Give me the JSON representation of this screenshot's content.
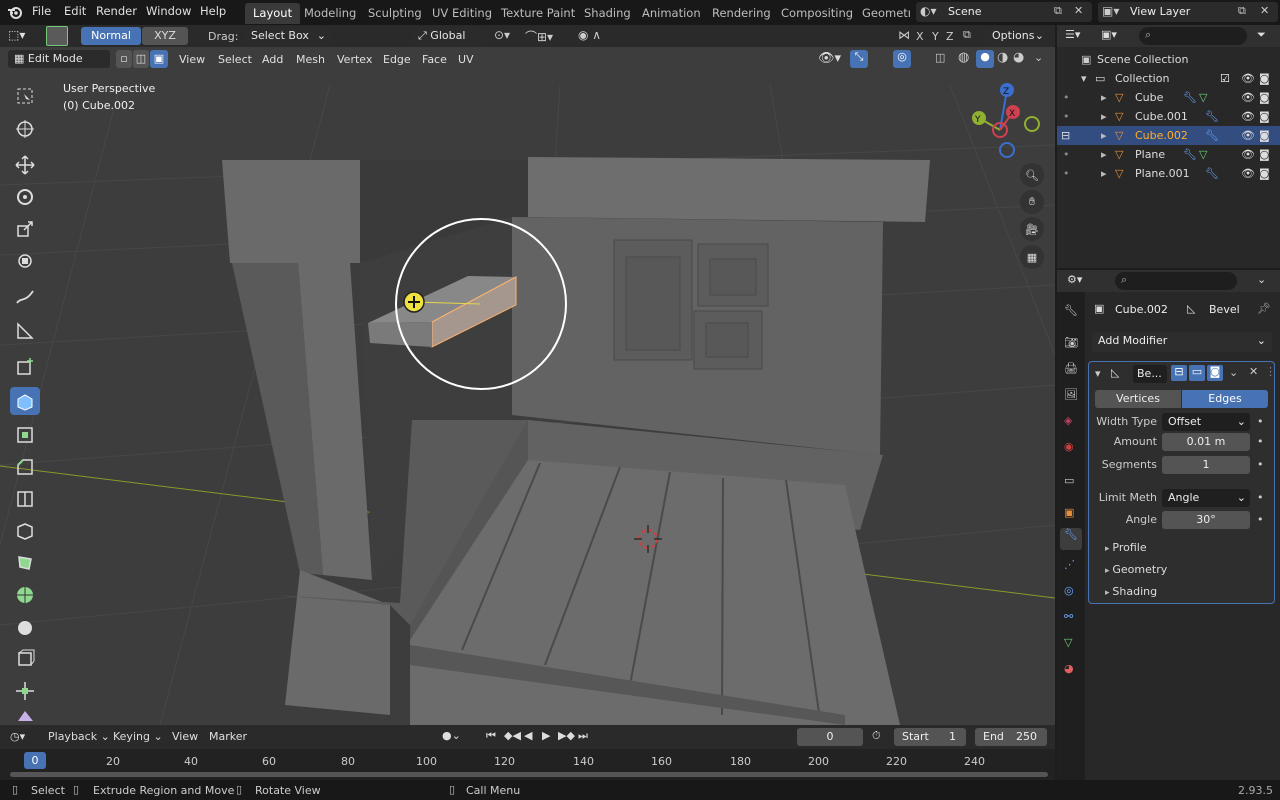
{
  "menus": {
    "file": "File",
    "edit": "Edit",
    "render": "Render",
    "window": "Window",
    "help": "Help"
  },
  "workspaces": [
    "Layout",
    "Modeling",
    "Sculpting",
    "UV Editing",
    "Texture Paint",
    "Shading",
    "Animation",
    "Rendering",
    "Compositing",
    "Geometr"
  ],
  "scene": "Scene",
  "view_layer": "View Layer",
  "toolbar": {
    "normal": "Normal",
    "xyz": "XYZ",
    "drag_label": "Drag:",
    "drag_value": "Select Box",
    "orientation": "Global",
    "options": "Options",
    "axis_x": "X",
    "axis_y": "Y",
    "axis_z": "Z"
  },
  "viewport_header": {
    "mode": "Edit Mode",
    "view": "View",
    "select": "Select",
    "add": "Add",
    "mesh": "Mesh",
    "vertex": "Vertex",
    "edge": "Edge",
    "face": "Face",
    "uv": "UV"
  },
  "viewport_overlay": {
    "perspective": "User Perspective",
    "object": "(0) Cube.002"
  },
  "gizmo": {
    "z": "Z",
    "y": "Y",
    "x": "X"
  },
  "outliner": {
    "root": "Scene Collection",
    "collection": "Collection",
    "items": [
      "Cube",
      "Cube.001",
      "Cube.002",
      "Plane",
      "Plane.001"
    ],
    "selected_index": 2
  },
  "properties": {
    "object": "Cube.002",
    "modifier_tab": "Bevel",
    "add_modifier": "Add Modifier",
    "modifier_name": "Be...",
    "affect_vertices": "Vertices",
    "affect_edges": "Edges",
    "width_type_label": "Width Type",
    "width_type": "Offset",
    "amount_label": "Amount",
    "amount": "0.01 m",
    "segments_label": "Segments",
    "segments": "1",
    "limit_label": "Limit Meth",
    "limit": "Angle",
    "angle_label": "Angle",
    "angle": "30°",
    "panels": [
      "Profile",
      "Geometry",
      "Shading"
    ]
  },
  "timeline": {
    "playback": "Playback",
    "keying": "Keying",
    "view": "View",
    "marker": "Marker",
    "current": "0",
    "start_label": "Start",
    "start": "1",
    "end_label": "End",
    "end": "250",
    "ticks": [
      "0",
      "20",
      "40",
      "60",
      "80",
      "100",
      "120",
      "140",
      "160",
      "180",
      "200",
      "220",
      "240"
    ]
  },
  "statusbar": {
    "select": "Select",
    "extrude": "Extrude Region and Move",
    "rotate": "Rotate View",
    "call_menu": "Call Menu",
    "version": "2.93.5"
  },
  "colors": {
    "accent": "#4772b3",
    "active_edges": "#4772b3",
    "header": "#2a2a2a",
    "viewport": "#3d3d3d",
    "selected_text": "#ffaf29"
  }
}
